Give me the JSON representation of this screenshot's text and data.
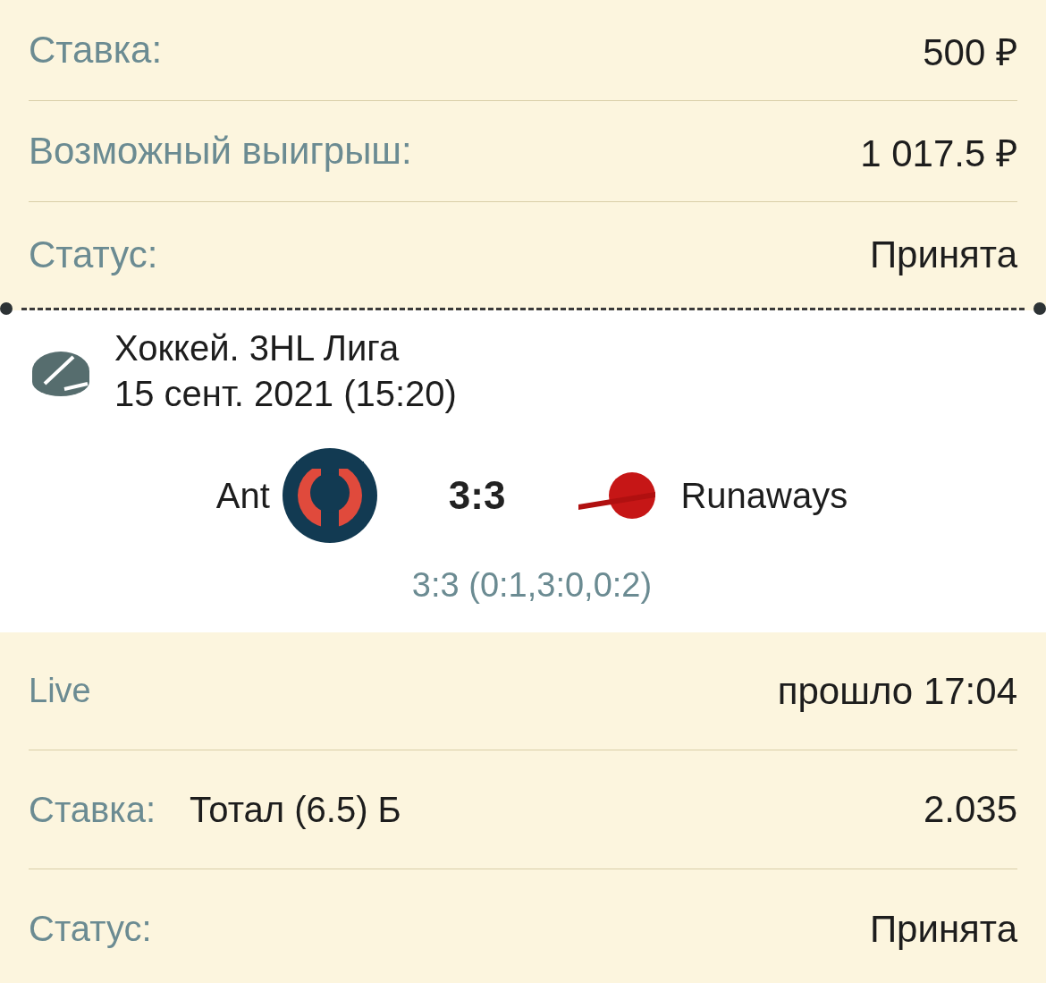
{
  "summary": [
    {
      "label": "Ставка:",
      "value": "500 ₽"
    },
    {
      "label": "Возможный выигрыш:",
      "value": "1 017.5 ₽"
    },
    {
      "label": "Статус:",
      "value": "Принята"
    }
  ],
  "event": {
    "league": "Хоккей. 3HL Лига",
    "date": "15 сент. 2021 (15:20)",
    "home": "Ant",
    "away": "Runaways",
    "score": "3:3",
    "periods": "3:3 (0:1,3:0,0:2)"
  },
  "details": [
    {
      "kind": "live",
      "label": "Live",
      "value": "прошло 17:04"
    },
    {
      "kind": "bet",
      "label": "Ставка:",
      "market": "Тотал (6.5) Б",
      "value": "2.035"
    },
    {
      "kind": "status",
      "label": "Статус:",
      "value": "Принята"
    }
  ]
}
